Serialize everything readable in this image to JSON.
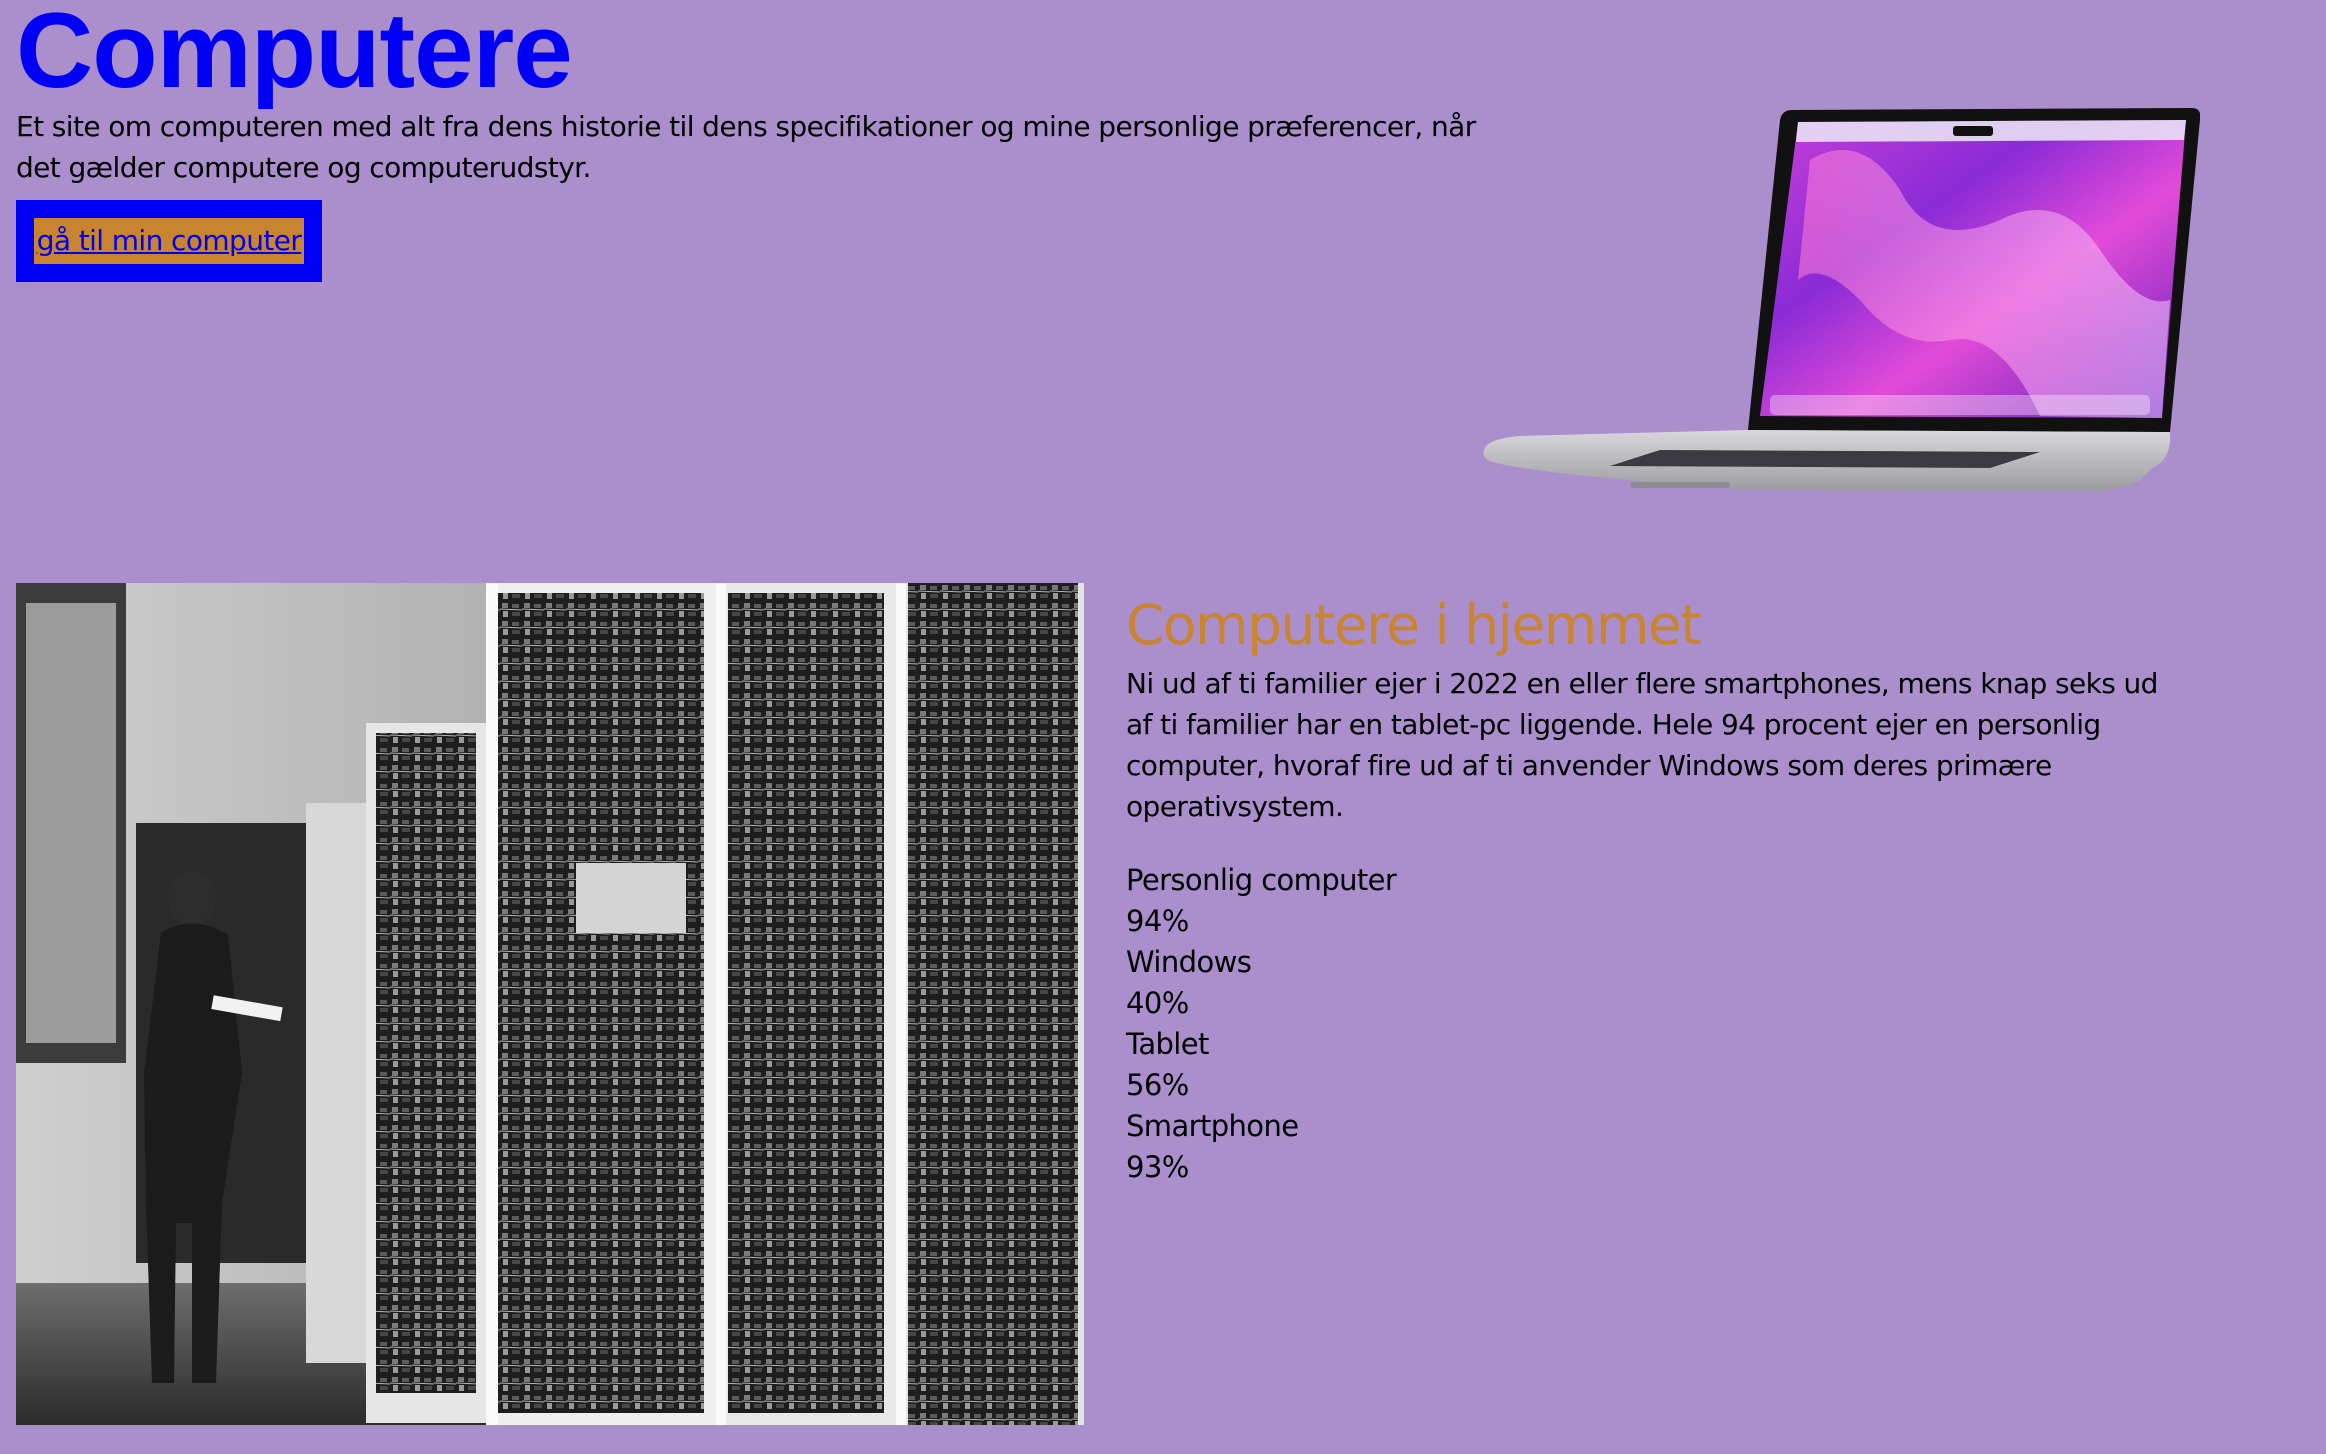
{
  "header": {
    "title": "Computere",
    "intro": "Et site om computeren med alt fra dens historie til dens specifikationer og mine personlige præferencer, når det gælder computere og computerudstyr.",
    "cta_label": "gå til min computer"
  },
  "section": {
    "title": "Computere i hjemmet",
    "body": "Ni ud af ti familier ejer i 2022 en eller flere smartphones, mens knap seks ud af ti familier har en tablet-pc liggende. Hele 94 procent ejer en personlig computer, hvoraf fire ud af ti anvender Windows som deres primære operativsystem.",
    "stats": [
      {
        "label": "Personlig computer",
        "value": "94%"
      },
      {
        "label": "Windows",
        "value": "40%"
      },
      {
        "label": "Tablet",
        "value": "56%"
      },
      {
        "label": "Smartphone",
        "value": "93%"
      }
    ]
  },
  "colors": {
    "background": "#ab8fcc",
    "title": "#0000f5",
    "accent": "#c9842f",
    "link": "#0000ee"
  }
}
